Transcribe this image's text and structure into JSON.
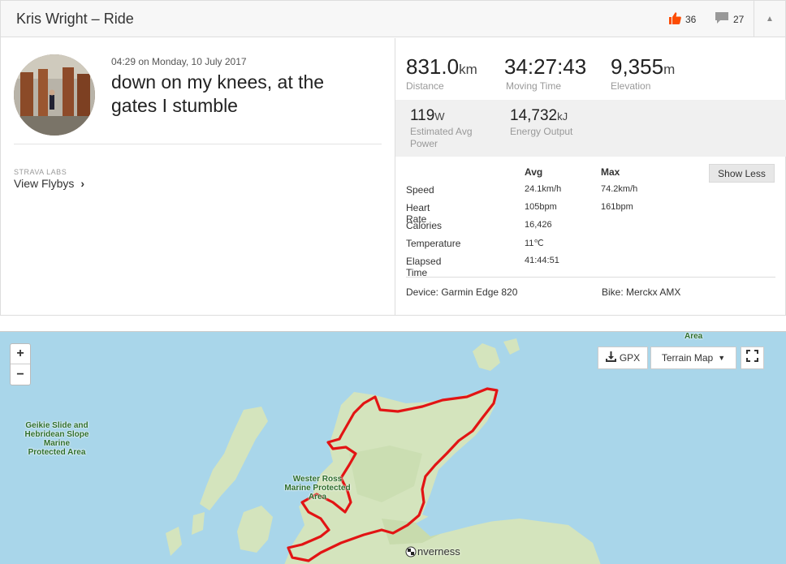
{
  "header": {
    "title": "Kris Wright – Ride",
    "kudos_count": "36",
    "comments_count": "27"
  },
  "activity": {
    "date": "04:29 on Monday, 10 July 2017",
    "name": "down on my knees, at the gates I stumble",
    "labs_label": "STRAVA LABS",
    "flybys_label": "View Flybys"
  },
  "stats": {
    "distance": {
      "value": "831.0",
      "unit": "km",
      "label": "Distance"
    },
    "moving_time": {
      "value": "34:27:43",
      "label": "Moving Time"
    },
    "elevation": {
      "value": "9,355",
      "unit": "m",
      "label": "Elevation"
    },
    "power": {
      "value": "119",
      "unit": "W",
      "label": "Estimated Avg Power"
    },
    "energy": {
      "value": "14,732",
      "unit": "kJ",
      "label": "Energy Output"
    }
  },
  "detail_table": {
    "col_avg": "Avg",
    "col_max": "Max",
    "show_less_label": "Show Less",
    "rows": [
      {
        "label": "Speed",
        "avg": "24.1km/h",
        "max": "74.2km/h"
      },
      {
        "label": "Heart Rate",
        "avg": "105bpm",
        "max": "161bpm"
      },
      {
        "label": "Calories",
        "avg": "16,426",
        "max": ""
      },
      {
        "label": "Temperature",
        "avg": "11℃",
        "max": ""
      },
      {
        "label": "Elapsed Time",
        "avg": "41:44:51",
        "max": ""
      }
    ],
    "device": "Device: Garmin Edge 820",
    "bike": "Bike: Merckx AMX"
  },
  "map": {
    "zoom_in": "+",
    "zoom_out": "−",
    "gpx_label": "GPX",
    "terrain_label": "Terrain Map",
    "labels": {
      "geikie": "Geikie Slide and Hebridean Slope Marine Protected Area",
      "wester_ross": "Wester Ross Marine Protected Area",
      "area_top": "Area",
      "town": "nverness"
    },
    "route_color": "#e21414",
    "water_color": "#a9d6ea",
    "land_color": "#d7e6c3"
  },
  "colors": {
    "accent": "#fc4c02"
  }
}
